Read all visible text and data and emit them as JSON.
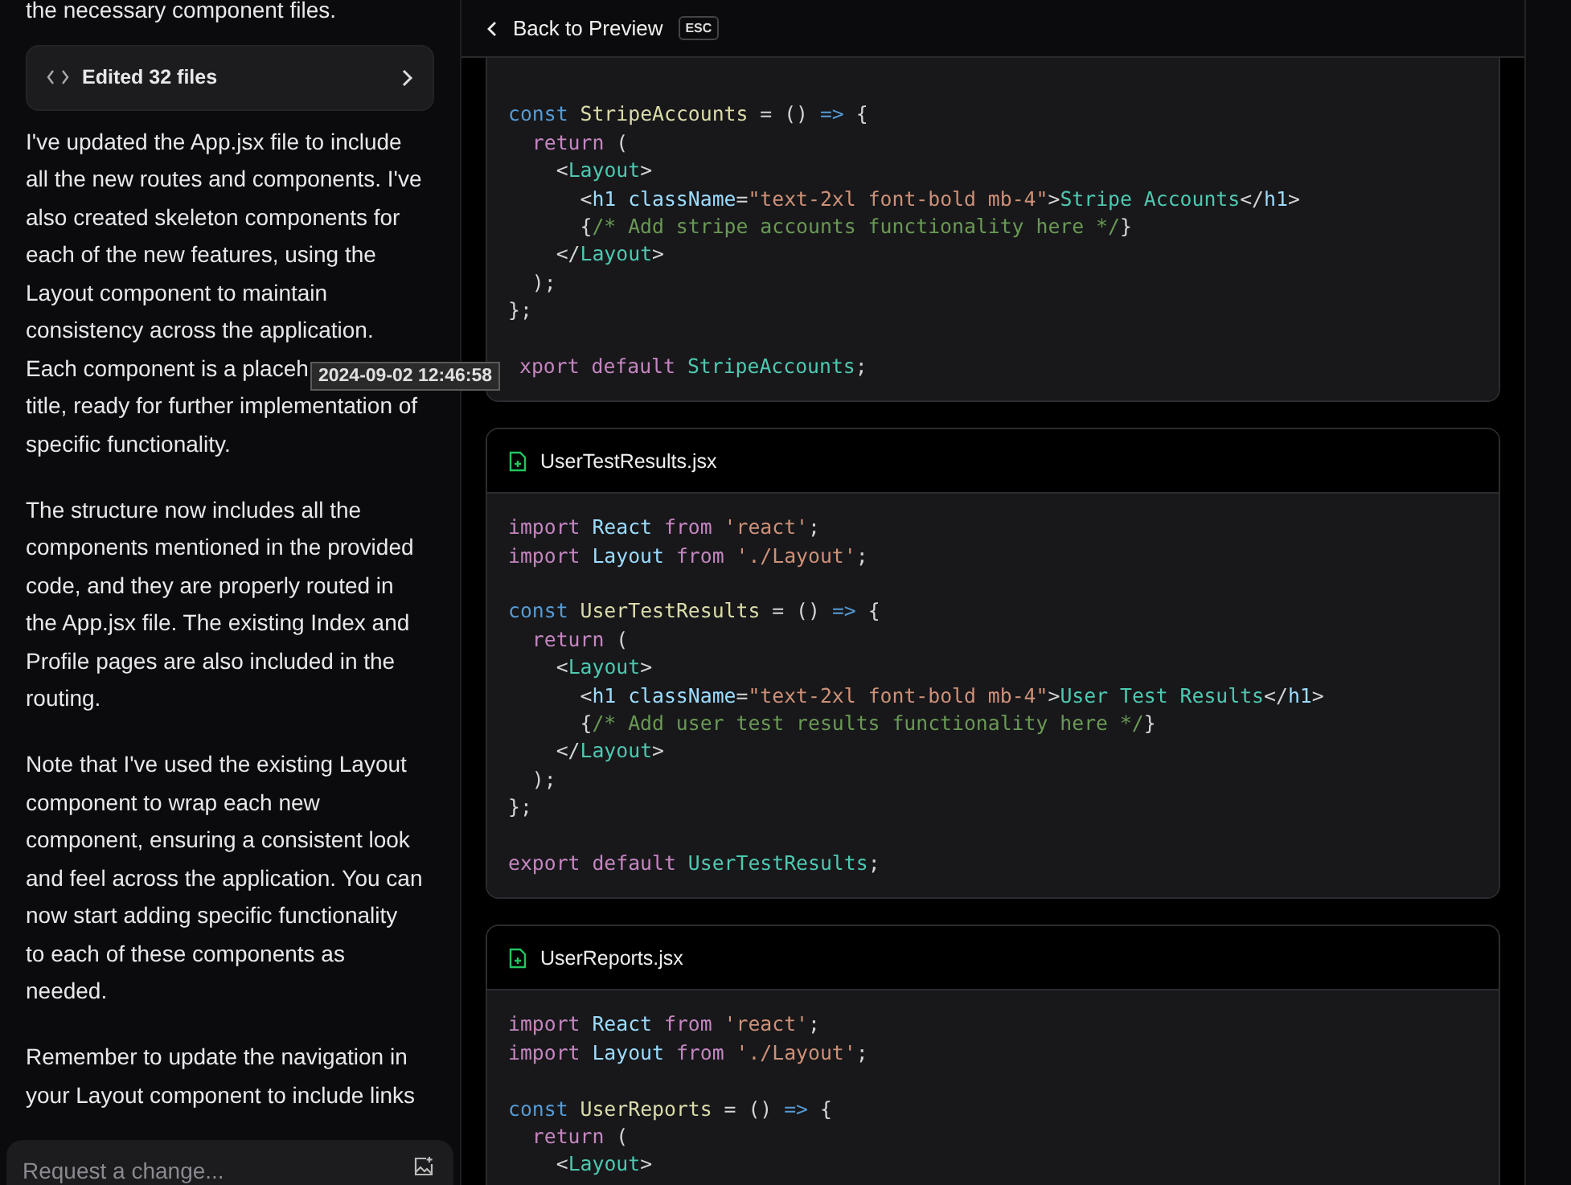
{
  "chat": {
    "lead": "the necessary component files.",
    "edited_files": {
      "label": "Edited 32 files"
    },
    "paragraphs": [
      {
        "lines": [
          "I've updated the App.jsx file to include",
          "all the new routes and components. I've",
          "also created skeleton components for",
          "each of the new features, using the",
          "Layout component to maintain",
          "consistency across the application.",
          "Each component is a placeh",
          "title, ready for further implementation of",
          "specific functionality."
        ]
      },
      {
        "lines": [
          "The structure now includes all the",
          "components mentioned in the provided",
          "code, and they are properly routed in",
          "the App.jsx file. The existing Index and",
          "Profile pages are also included in the",
          "routing."
        ]
      },
      {
        "lines": [
          "Note that I've used the existing Layout",
          "component to wrap each new",
          "component, ensuring a consistent look",
          "and feel across the application. You can",
          "now start adding specific functionality",
          "to each of these components as",
          "needed."
        ]
      },
      {
        "lines": [
          "Remember to update the navigation in",
          "your Layout component to include links"
        ]
      }
    ],
    "timestamp_tooltip": "2024-09-02 12:46:58",
    "input": {
      "placeholder": "Request a change..."
    }
  },
  "header": {
    "back_label": "Back to Preview",
    "shortcut": "ESC"
  },
  "files": [
    {
      "kind": "scrolled",
      "lines": [
        {
          "kind": "blank"
        },
        {
          "kind": "code",
          "tokens": [
            {
              "text": "const ",
              "kind": "storage"
            },
            {
              "text": "StripeAccounts",
              "kind": "function"
            },
            {
              "text": " = () ",
              "kind": "plain"
            },
            {
              "text": "=>",
              "kind": "storage"
            },
            {
              "text": " {",
              "kind": "plain"
            }
          ]
        },
        {
          "kind": "code",
          "tokens": [
            {
              "text": "  return",
              "kind": "keyword"
            },
            {
              "text": " (",
              "kind": "plain"
            }
          ]
        },
        {
          "kind": "code",
          "tokens": [
            {
              "text": "    <",
              "kind": "plain"
            },
            {
              "text": "Layout",
              "kind": "tag"
            },
            {
              "text": ">",
              "kind": "plain"
            }
          ]
        },
        {
          "kind": "code",
          "tokens": [
            {
              "text": "      <",
              "kind": "plain"
            },
            {
              "text": "h1 className",
              "kind": "variable"
            },
            {
              "text": "=",
              "kind": "plain"
            },
            {
              "text": "\"text-2xl font-bold mb-4\"",
              "kind": "string"
            },
            {
              "text": ">",
              "kind": "plain"
            },
            {
              "text": "Stripe Accounts",
              "kind": "tag"
            },
            {
              "text": "</",
              "kind": "plain"
            },
            {
              "text": "h1",
              "kind": "variable"
            },
            {
              "text": ">",
              "kind": "plain"
            }
          ]
        },
        {
          "kind": "code",
          "tokens": [
            {
              "text": "      {",
              "kind": "plain"
            },
            {
              "text": "/* Add stripe accounts functionality here */",
              "kind": "comment"
            },
            {
              "text": "}",
              "kind": "plain"
            }
          ]
        },
        {
          "kind": "code",
          "tokens": [
            {
              "text": "    </",
              "kind": "plain"
            },
            {
              "text": "Layout",
              "kind": "tag"
            },
            {
              "text": ">",
              "kind": "plain"
            }
          ]
        },
        {
          "kind": "code",
          "tokens": [
            {
              "text": "  );",
              "kind": "plain"
            }
          ]
        },
        {
          "kind": "code",
          "tokens": [
            {
              "text": "};",
              "kind": "plain"
            }
          ]
        },
        {
          "kind": "blank"
        },
        {
          "kind": "code",
          "tokens": [
            {
              "text": "xport default ",
              "kind": "keyword"
            },
            {
              "text": "StripeAccounts",
              "kind": "tag"
            },
            {
              "text": ";",
              "kind": "plain"
            }
          ]
        }
      ]
    },
    {
      "kind": "full",
      "name": "UserTestResults.jsx",
      "lines": [
        {
          "kind": "code",
          "tokens": [
            {
              "text": "import ",
              "kind": "keyword"
            },
            {
              "text": "React ",
              "kind": "variable"
            },
            {
              "text": "from ",
              "kind": "keyword"
            },
            {
              "text": "'react'",
              "kind": "string"
            },
            {
              "text": ";",
              "kind": "plain"
            }
          ]
        },
        {
          "kind": "code",
          "tokens": [
            {
              "text": "import ",
              "kind": "keyword"
            },
            {
              "text": "Layout ",
              "kind": "variable"
            },
            {
              "text": "from ",
              "kind": "keyword"
            },
            {
              "text": "'./Layout'",
              "kind": "string"
            },
            {
              "text": ";",
              "kind": "plain"
            }
          ]
        },
        {
          "kind": "blank"
        },
        {
          "kind": "code",
          "tokens": [
            {
              "text": "const ",
              "kind": "storage"
            },
            {
              "text": "UserTestResults",
              "kind": "function"
            },
            {
              "text": " = () ",
              "kind": "plain"
            },
            {
              "text": "=>",
              "kind": "storage"
            },
            {
              "text": " {",
              "kind": "plain"
            }
          ]
        },
        {
          "kind": "code",
          "tokens": [
            {
              "text": "  return",
              "kind": "keyword"
            },
            {
              "text": " (",
              "kind": "plain"
            }
          ]
        },
        {
          "kind": "code",
          "tokens": [
            {
              "text": "    <",
              "kind": "plain"
            },
            {
              "text": "Layout",
              "kind": "tag"
            },
            {
              "text": ">",
              "kind": "plain"
            }
          ]
        },
        {
          "kind": "code",
          "tokens": [
            {
              "text": "      <",
              "kind": "plain"
            },
            {
              "text": "h1 className",
              "kind": "variable"
            },
            {
              "text": "=",
              "kind": "plain"
            },
            {
              "text": "\"text-2xl font-bold mb-4\"",
              "kind": "string"
            },
            {
              "text": ">",
              "kind": "plain"
            },
            {
              "text": "User Test Results",
              "kind": "tag"
            },
            {
              "text": "</",
              "kind": "plain"
            },
            {
              "text": "h1",
              "kind": "variable"
            },
            {
              "text": ">",
              "kind": "plain"
            }
          ]
        },
        {
          "kind": "code",
          "tokens": [
            {
              "text": "      {",
              "kind": "plain"
            },
            {
              "text": "/* Add user test results functionality here */",
              "kind": "comment"
            },
            {
              "text": "}",
              "kind": "plain"
            }
          ]
        },
        {
          "kind": "code",
          "tokens": [
            {
              "text": "    </",
              "kind": "plain"
            },
            {
              "text": "Layout",
              "kind": "tag"
            },
            {
              "text": ">",
              "kind": "plain"
            }
          ]
        },
        {
          "kind": "code",
          "tokens": [
            {
              "text": "  );",
              "kind": "plain"
            }
          ]
        },
        {
          "kind": "code",
          "tokens": [
            {
              "text": "};",
              "kind": "plain"
            }
          ]
        },
        {
          "kind": "blank"
        },
        {
          "kind": "code",
          "tokens": [
            {
              "text": "export default ",
              "kind": "keyword"
            },
            {
              "text": "UserTestResults",
              "kind": "tag"
            },
            {
              "text": ";",
              "kind": "plain"
            }
          ]
        }
      ]
    },
    {
      "kind": "full",
      "name": "UserReports.jsx",
      "lines": [
        {
          "kind": "code",
          "tokens": [
            {
              "text": "import ",
              "kind": "keyword"
            },
            {
              "text": "React ",
              "kind": "variable"
            },
            {
              "text": "from ",
              "kind": "keyword"
            },
            {
              "text": "'react'",
              "kind": "string"
            },
            {
              "text": ";",
              "kind": "plain"
            }
          ]
        },
        {
          "kind": "code",
          "tokens": [
            {
              "text": "import ",
              "kind": "keyword"
            },
            {
              "text": "Layout ",
              "kind": "variable"
            },
            {
              "text": "from ",
              "kind": "keyword"
            },
            {
              "text": "'./Layout'",
              "kind": "string"
            },
            {
              "text": ";",
              "kind": "plain"
            }
          ]
        },
        {
          "kind": "blank"
        },
        {
          "kind": "code",
          "tokens": [
            {
              "text": "const ",
              "kind": "storage"
            },
            {
              "text": "UserReports",
              "kind": "function"
            },
            {
              "text": " = () ",
              "kind": "plain"
            },
            {
              "text": "=>",
              "kind": "storage"
            },
            {
              "text": " {",
              "kind": "plain"
            }
          ]
        },
        {
          "kind": "code",
          "tokens": [
            {
              "text": "  return",
              "kind": "keyword"
            },
            {
              "text": " (",
              "kind": "plain"
            }
          ]
        },
        {
          "kind": "code",
          "tokens": [
            {
              "text": "    <",
              "kind": "plain"
            },
            {
              "text": "Layout",
              "kind": "tag"
            },
            {
              "text": ">",
              "kind": "plain"
            }
          ]
        }
      ]
    }
  ]
}
